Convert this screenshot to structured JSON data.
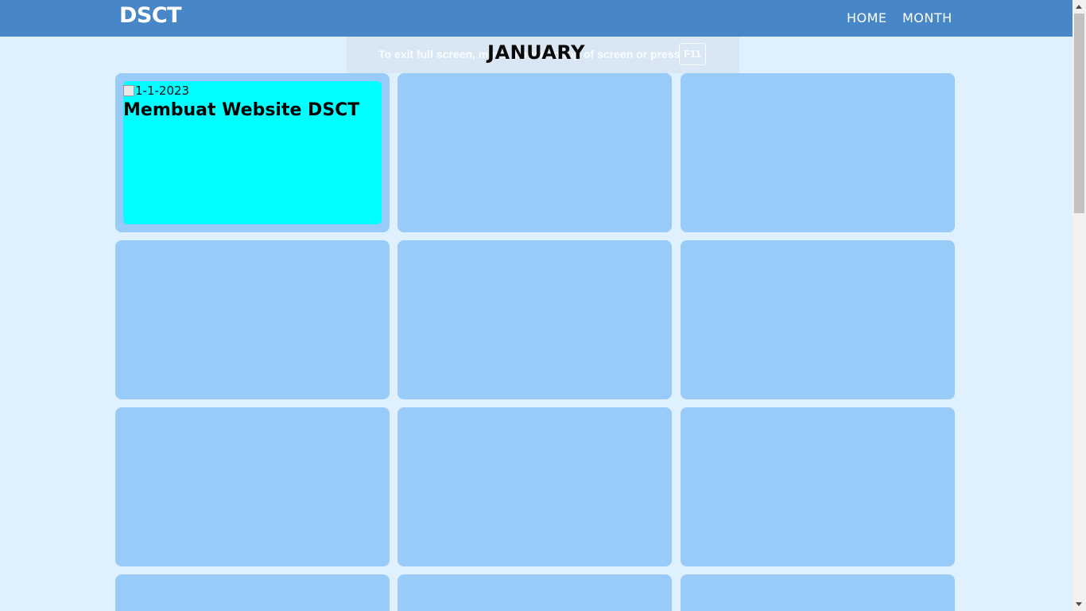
{
  "header": {
    "logo": "DSCT",
    "nav": {
      "home": "HOME",
      "month": "MONTH"
    }
  },
  "fullscreen_notice": {
    "message": "To exit full screen, move mouse to top of screen or press",
    "key": "F11"
  },
  "page": {
    "month": "JANUARY"
  },
  "events": [
    {
      "image_alt": "1-1-2023",
      "title": "Membuat Website DSCT"
    }
  ],
  "colors": {
    "navbar": "#4787c8",
    "background": "#dff0ff",
    "card": "#99cbf9",
    "event": "#00ffff"
  }
}
